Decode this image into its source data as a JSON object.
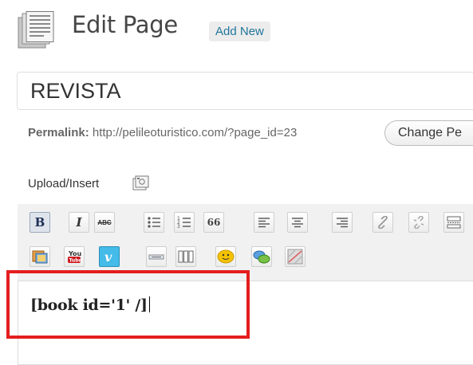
{
  "header": {
    "title": "Edit Page",
    "add_new_label": "Add New"
  },
  "title_field": {
    "value": "REVISTA"
  },
  "permalink": {
    "label": "Permalink:",
    "url": "http://pelileoturistico.com/?page_id=23",
    "change_button_label": "Change Pe"
  },
  "upload": {
    "label": "Upload/Insert"
  },
  "toolbar": {
    "row1": [
      "bold",
      "italic",
      "strikethrough",
      "bullet-list",
      "numbered-list",
      "blockquote",
      "align-left",
      "align-center",
      "align-right",
      "link",
      "unlink",
      "more"
    ],
    "row2": [
      "image-gallery",
      "youtube",
      "vimeo",
      "horizontal-rule",
      "columns",
      "emoticon",
      "comment",
      "map"
    ],
    "bold_label": "B",
    "italic_label": "I",
    "strike_label": "ABC",
    "quote_label": "66"
  },
  "editor": {
    "content": "[book id='1' /]"
  },
  "colors": {
    "highlight": "#e41e1e",
    "link": "#21759b"
  }
}
